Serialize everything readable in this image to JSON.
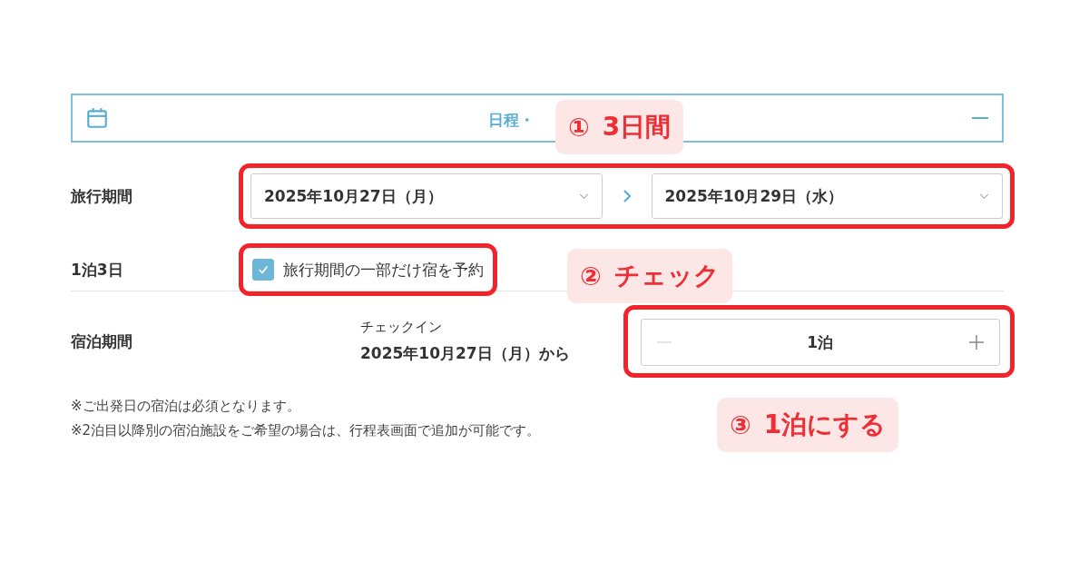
{
  "header": {
    "title": "日程・",
    "expanded": true
  },
  "travel_period": {
    "label": "旅行期間",
    "start": "2025年10月27日（月）",
    "end": "2025年10月29日（水）"
  },
  "partial_stay": {
    "summary": "1泊3日",
    "label": "旅行期間の一部だけ宿を予約",
    "checked": true
  },
  "stay_period": {
    "label": "宿泊期間",
    "checkin_label": "チェックイン",
    "checkin_date": "2025年10月27日（月）から",
    "nights": "1泊",
    "decrement_disabled": true,
    "increment_disabled": false
  },
  "notes": [
    "※ご出発日の宿泊は必須となります。",
    "※2泊目以降別の宿泊施設をご希望の場合は、行程表画面で追加が可能です。"
  ],
  "annotations": [
    {
      "number": "①",
      "text": "3日間"
    },
    {
      "number": "②",
      "text": "チェック"
    },
    {
      "number": "③",
      "text": "1泊にする"
    }
  ]
}
